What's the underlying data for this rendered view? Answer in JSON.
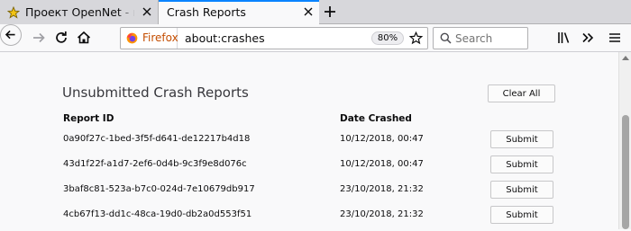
{
  "tabs": [
    {
      "title": "Проект OpenNet - всё, что",
      "active": false
    },
    {
      "title": "Crash Reports",
      "active": true
    }
  ],
  "toolbar": {
    "identity_label": "Firefox",
    "url": "about:crashes",
    "zoom": "80%",
    "search_placeholder": "Search"
  },
  "page": {
    "title": "Unsubmitted Crash Reports",
    "clear_all_label": "Clear All",
    "col_report_id": "Report ID",
    "col_date": "Date Crashed",
    "reports": [
      {
        "id": "0a90f27c-1bed-3f5f-d641-de12217b4d18",
        "date": "10/12/2018, 00:47",
        "action": "Submit"
      },
      {
        "id": "43d1f22f-a1d7-2ef6-0d4b-9c3f9e8d076c",
        "date": "10/12/2018, 00:47",
        "action": "Submit"
      },
      {
        "id": "3baf8c81-523a-b7c0-024d-7e10679db917",
        "date": "23/10/2018, 21:32",
        "action": "Submit"
      },
      {
        "id": "4cb67f13-dd1c-48ca-19d0-db2a0d553f51",
        "date": "23/10/2018, 21:32",
        "action": "Submit"
      }
    ]
  },
  "colors": {
    "accent": "#0a84ff",
    "tabstrip": "#d7d7db",
    "background": "#f9f9fa",
    "scroll_thumb": "#a6a6a6"
  },
  "icons": {
    "tab1_favicon": "star-icon",
    "identity": "firefox-logo-icon",
    "library": "library-icon",
    "overflow": "chevrons-right-icon",
    "menu": "hamburger-menu-icon"
  }
}
